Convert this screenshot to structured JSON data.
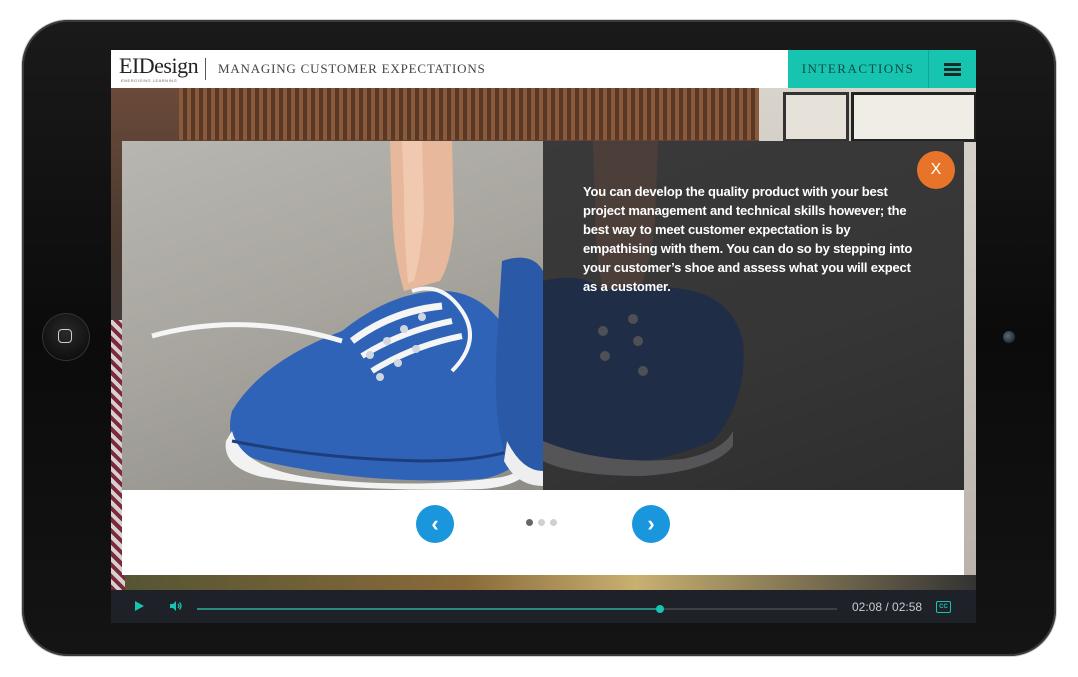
{
  "header": {
    "logo_text": "EIDesign",
    "logo_tagline": "ENERGISING LEARNING",
    "course_title": "MANAGING CUSTOMER EXPECTATIONS",
    "interactions_label": "INTERACTIONS"
  },
  "modal": {
    "close_label": "X",
    "body_text": "You can develop the quality product with your best project management and technical skills however; the best way to meet customer expectation is by empathising with them. You can do so by stepping into your customer’s shoe and assess what you will expect as a customer.",
    "prev_label": "‹",
    "next_label": "›",
    "slide_count": 3,
    "active_slide": 1
  },
  "player": {
    "time_display": "02:08 / 02:58",
    "progress_fraction": 0.724,
    "cc_label": "CC"
  },
  "colors": {
    "accent_teal": "#16c4b0",
    "close_orange": "#e8742a",
    "nav_blue": "#1a96dc",
    "player_bg": "#1e2128"
  }
}
